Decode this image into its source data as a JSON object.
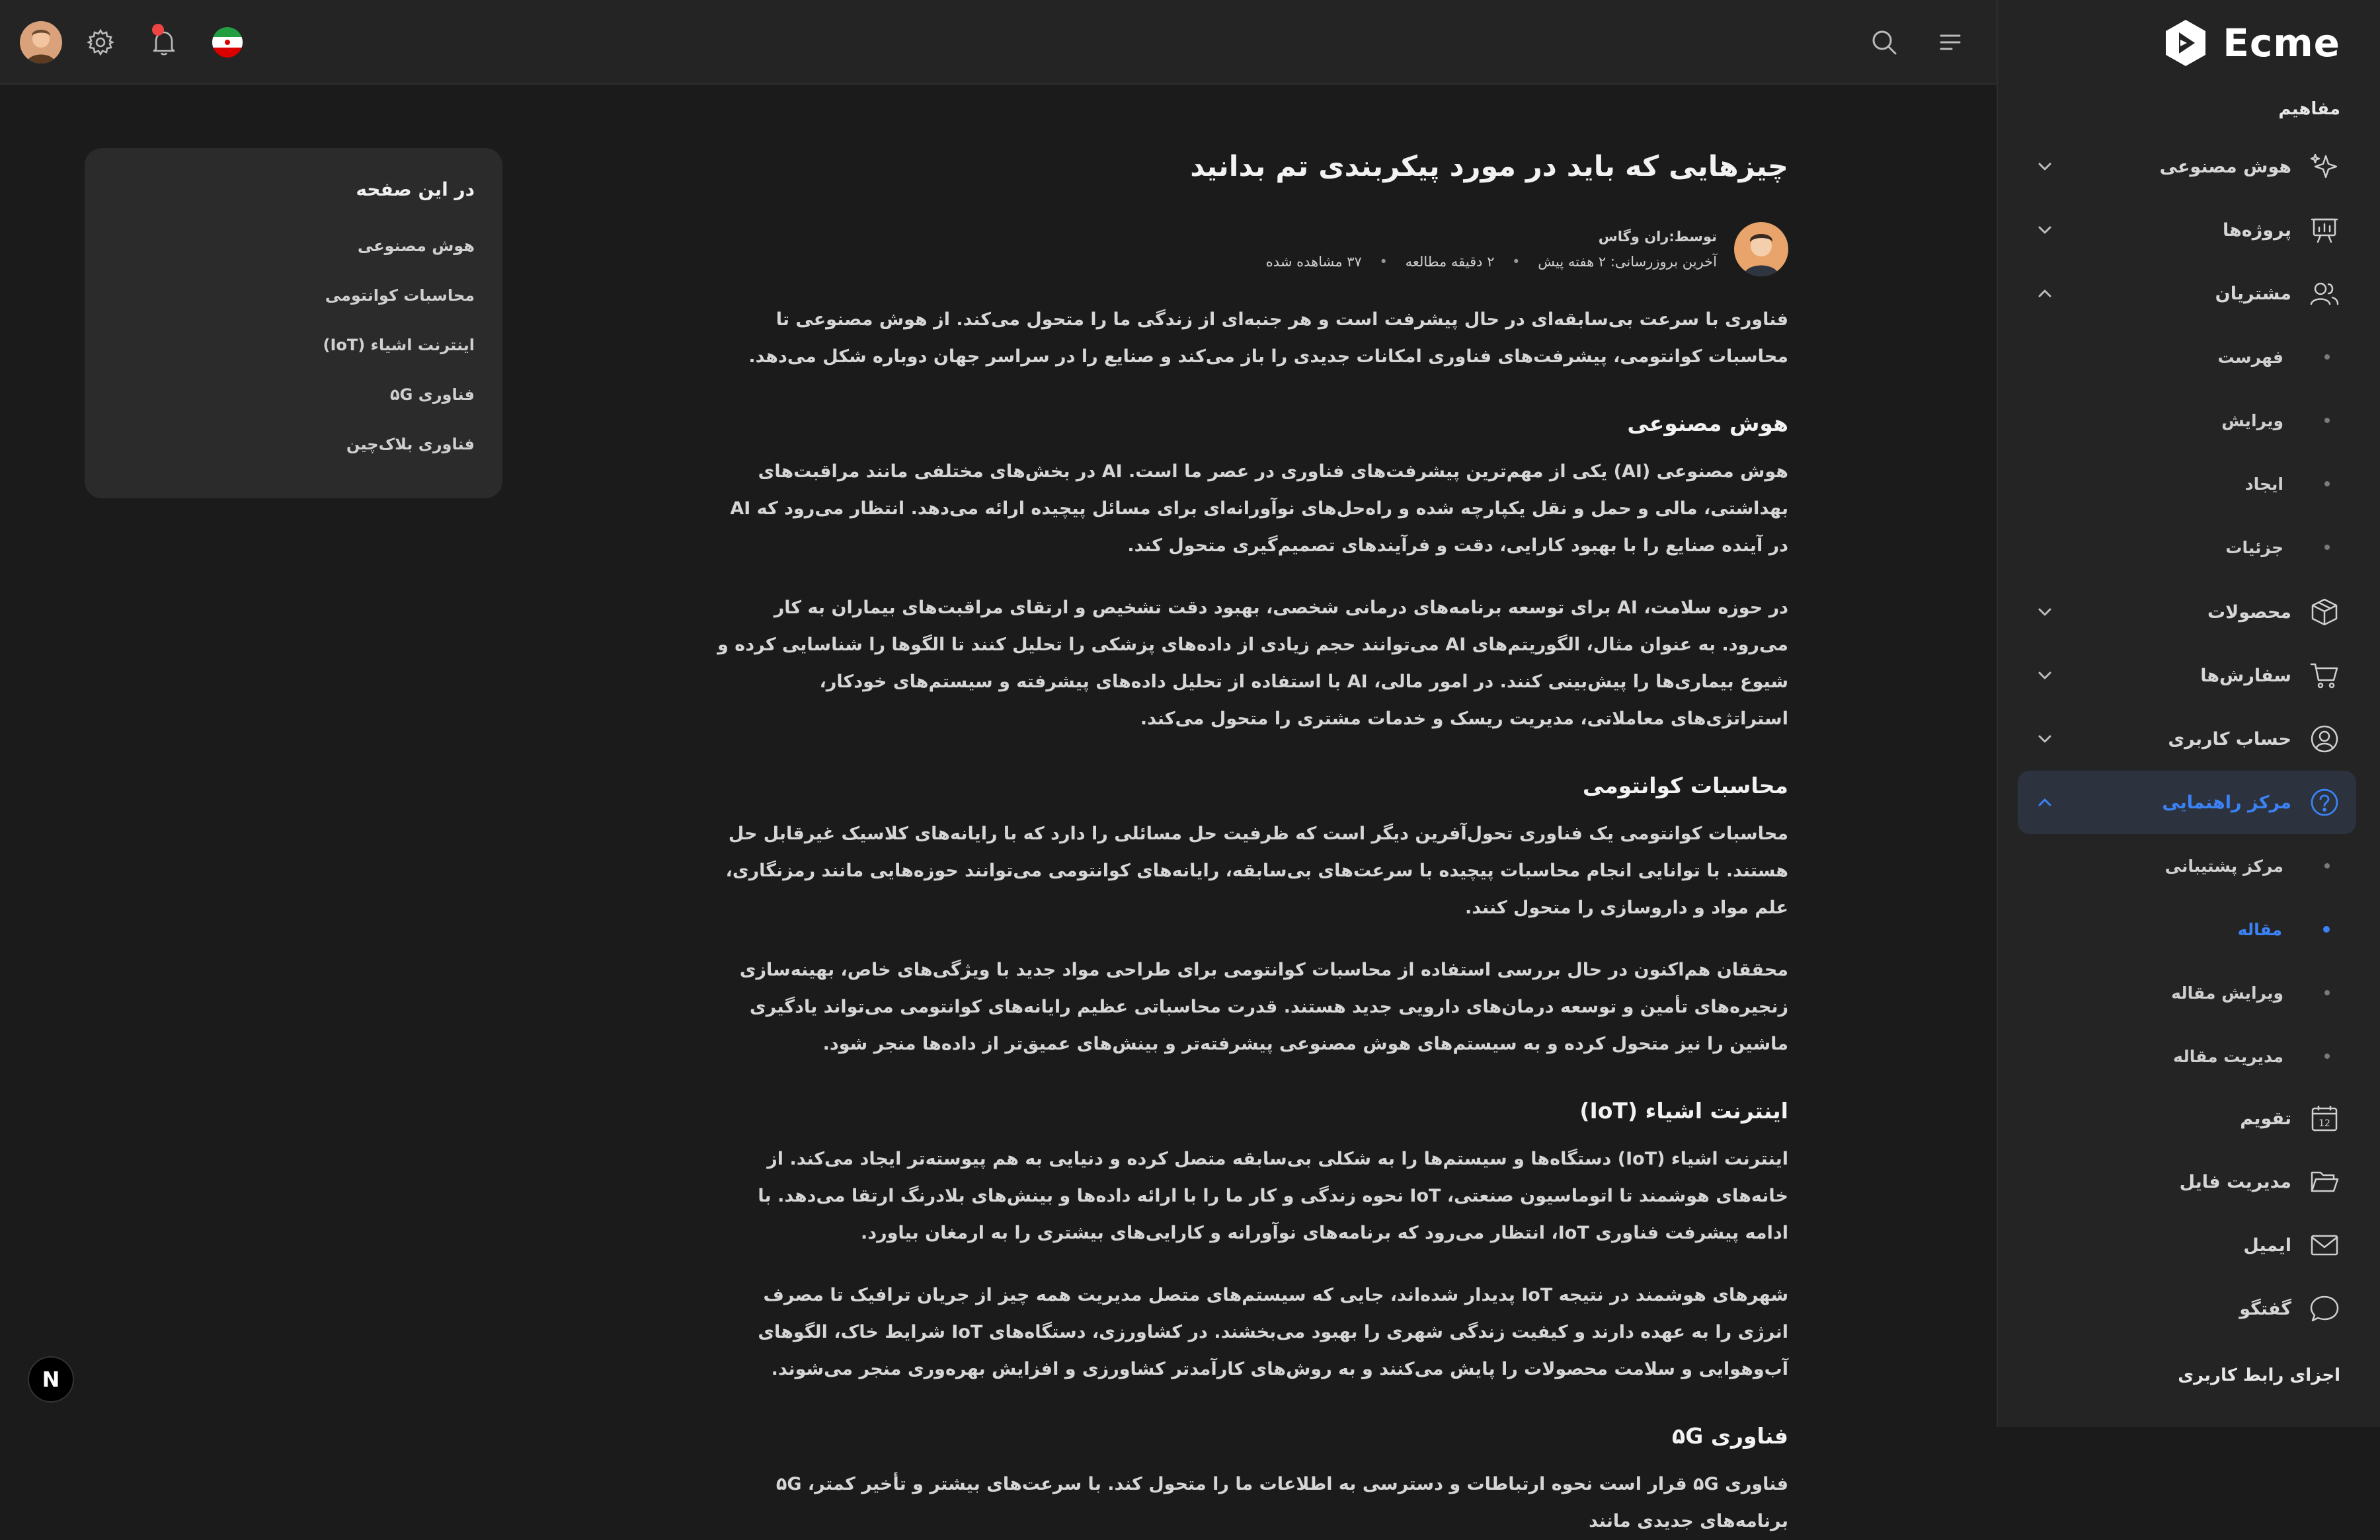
{
  "brand": {
    "name": "Ecme"
  },
  "sidebar": {
    "concepts_title": "مفاهیم",
    "items": [
      {
        "label": "هوش مصنوعی",
        "icon": "sparkles-icon",
        "expanded": false
      },
      {
        "label": "پروژه‌ها",
        "icon": "presentation-chart-icon",
        "expanded": false
      },
      {
        "label": "مشتریان",
        "icon": "users-icon",
        "expanded": true
      },
      {
        "label": "محصولات",
        "icon": "box-icon",
        "expanded": false
      },
      {
        "label": "سفارش‌ها",
        "icon": "cart-icon",
        "expanded": false
      },
      {
        "label": "حساب کاربری",
        "icon": "user-circle-icon",
        "expanded": false
      },
      {
        "label": "مرکز راهنمایی",
        "icon": "help-circle-icon",
        "expanded": true,
        "active": true
      },
      {
        "label": "تقویم",
        "icon": "calendar-icon"
      },
      {
        "label": "مدیریت فایل",
        "icon": "folder-icon"
      },
      {
        "label": "ایمیل",
        "icon": "mail-icon"
      },
      {
        "label": "گفتگو",
        "icon": "chat-icon"
      }
    ],
    "customers_sub": [
      "فهرست",
      "ویرایش",
      "ایجاد",
      "جزئیات"
    ],
    "help_sub": [
      "مرکز پشتیبانی",
      "مقاله",
      "ویرایش مقاله",
      "مدیریت مقاله"
    ],
    "help_active_sub": "مقاله",
    "ui_components_title": "اجزای رابط کاربری"
  },
  "header": {
    "icons": [
      "avatar",
      "gear-icon",
      "bell-icon",
      "iran-flag-icon",
      "search-icon",
      "menu-icon"
    ]
  },
  "article": {
    "title": "چیزهایی که باید در مورد پیکربندی تم بدانید",
    "author_prefix": "توسط:",
    "author_name": "ران وگاس",
    "last_updated": "آخرین بروزرسانی: ۲ هفته پیش",
    "read_time": "۲ دقیقه مطالعه",
    "views": "۳۷ مشاهده شده",
    "intro": "فناوری با سرعت بی‌سابقه‌ای در حال پیشرفت است و هر جنبه‌ای از زندگی ما را متحول می‌کند. از هوش مصنوعی تا محاسبات کوانتومی، پیشرفت‌های فناوری امکانات جدیدی را باز می‌کند و صنایع را در سراسر جهان دوباره شکل می‌دهد.",
    "sections": [
      {
        "heading": "هوش مصنوعی",
        "paragraphs": [
          "هوش مصنوعی (AI) یکی از مهم‌ترین پیشرفت‌های فناوری در عصر ما است. AI در بخش‌های مختلفی مانند مراقبت‌های بهداشتی، مالی و حمل و نقل یکپارچه شده و راه‌حل‌های نوآورانه‌ای برای مسائل پیچیده ارائه می‌دهد. انتظار می‌رود که AI در آینده صنایع را با بهبود کارایی، دقت و فرآیندهای تصمیم‌گیری متحول کند.",
          "در حوزه سلامت، AI برای توسعه برنامه‌های درمانی شخصی، بهبود دقت تشخیص و ارتقای مراقبت‌های بیماران به کار می‌رود. به عنوان مثال، الگوریتم‌های AI می‌توانند حجم زیادی از داده‌های پزشکی را تحلیل کنند تا الگوها را شناسایی کرده و شیوع بیماری‌ها را پیش‌بینی کنند. در امور مالی، AI با استفاده از تحلیل داده‌های پیشرفته و سیستم‌های خودکار، استراتژی‌های معاملاتی، مدیریت ریسک و خدمات مشتری را متحول می‌کند."
        ]
      },
      {
        "heading": "محاسبات کوانتومی",
        "paragraphs": [
          "محاسبات کوانتومی یک فناوری تحول‌آفرین دیگر است که ظرفیت حل مسائلی را دارد که با رایانه‌های کلاسیک غیرقابل حل هستند. با توانایی انجام محاسبات پیچیده با سرعت‌های بی‌سابقه، رایانه‌های کوانتومی می‌توانند حوزه‌هایی مانند رمزنگاری، علم مواد و داروسازی را متحول کنند.",
          "محققان هم‌اکنون در حال بررسی استفاده از محاسبات کوانتومی برای طراحی مواد جدید با ویژگی‌های خاص، بهینه‌سازی زنجیره‌های تأمین و توسعه درمان‌های دارویی جدید هستند. قدرت محاسباتی عظیم رایانه‌های کوانتومی می‌تواند یادگیری ماشین را نیز متحول کرده و به سیستم‌های هوش مصنوعی پیشرفته‌تر و بینش‌های عمیق‌تر از داده‌ها منجر شود."
        ]
      },
      {
        "heading": "اینترنت اشیاء (IoT)",
        "paragraphs": [
          "اینترنت اشیاء (IoT) دستگاه‌ها و سیستم‌ها را به شکلی بی‌سابقه متصل کرده و دنیایی به هم پیوسته‌تر ایجاد می‌کند. از خانه‌های هوشمند تا اتوماسیون صنعتی، IoT نحوه زندگی و کار ما را با ارائه داده‌ها و بینش‌های بلادرنگ ارتقا می‌دهد. با ادامه پیشرفت فناوری IoT، انتظار می‌رود که برنامه‌های نوآورانه و کارایی‌های بیشتری را به ارمغان بیاورد.",
          "شهرهای هوشمند در نتیجه IoT پدیدار شده‌اند، جایی که سیستم‌های متصل مدیریت همه چیز از جریان ترافیک تا مصرف انرژی را به عهده دارند و کیفیت زندگی شهری را بهبود می‌بخشند. در کشاورزی، دستگاه‌های IoT شرایط خاک، الگوهای آب‌وهوایی و سلامت محصولات را پایش می‌کنند و به روش‌های کارآمدتر کشاورزی و افزایش بهره‌وری منجر می‌شوند."
        ]
      },
      {
        "heading": "فناوری ۵G",
        "paragraphs": [
          "فناوری ۵G قرار است نحوه ارتباطات و دسترسی به اطلاعات ما را متحول کند. با سرعت‌های بیشتر و تأخیر کمتر، ۵G برنامه‌های جدیدی مانند"
        ]
      }
    ]
  },
  "toc": {
    "title": "در این صفحه",
    "items": [
      "هوش مصنوعی",
      "محاسبات کوانتومی",
      "اینترنت اشیاء (IoT)",
      "فناوری ۵G",
      "فناوری بلاک‌چین"
    ]
  },
  "badge": {
    "letter": "N"
  },
  "colors": {
    "accent": "#3b82f6",
    "background": "#1b1b1b",
    "sidebar": "#242424",
    "card": "#2b2b2b",
    "notification": "#ef4444"
  }
}
